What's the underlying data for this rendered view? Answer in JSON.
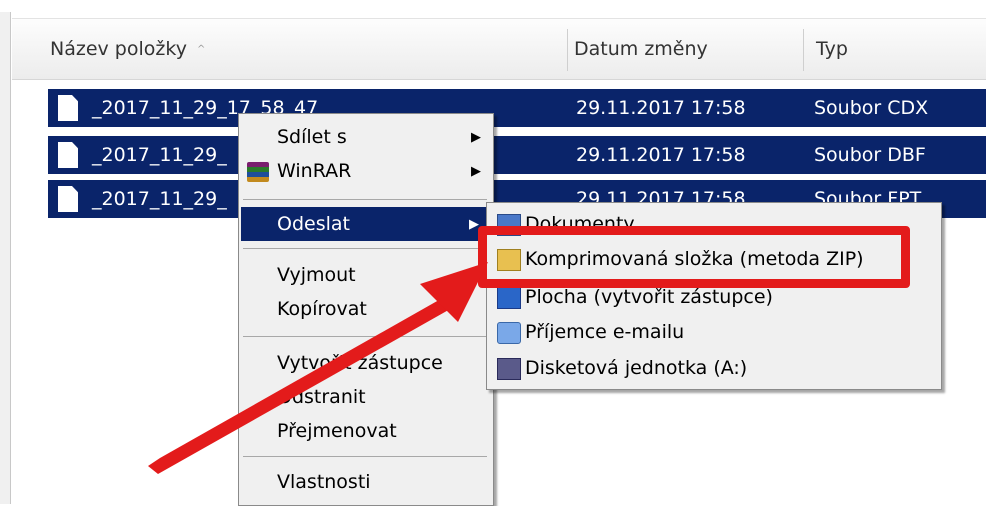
{
  "columns": {
    "name": "Název položky",
    "date": "Datum změny",
    "type": "Typ"
  },
  "sort_indicator": "^",
  "files": [
    {
      "name": "_2017_11_29_17_58_47",
      "date": "29.11.2017 17:58",
      "type": "Soubor CDX"
    },
    {
      "name": "_2017_11_29_",
      "date": "29.11.2017 17:58",
      "type": "Soubor DBF"
    },
    {
      "name": "_2017_11_29_",
      "date": "29.11.2017 17:58",
      "type": "Soubor FPT"
    }
  ],
  "context_menu": {
    "share": "Sdílet s",
    "winrar": "WinRAR",
    "send_to": "Odeslat",
    "cut": "Vyjmout",
    "copy": "Kopírovat",
    "create_shortcut": "Vytvořit zástupce",
    "delete": "Odstranit",
    "rename": "Přejmenovat",
    "properties": "Vlastnosti"
  },
  "submenu_send_to": {
    "documents": "Dokumenty",
    "zip": "Komprimovaná složka (metoda ZIP)",
    "desktop": "Plocha (vytvořit zástupce)",
    "mail": "Příjemce e-mailu",
    "floppy": "Disketová jednotka (A:)"
  },
  "colors": {
    "selection": "#0a246a",
    "callout": "#e31b1b",
    "menu_bg": "#f0f0f0"
  },
  "icons": {
    "submenu_arrow": "▶"
  }
}
